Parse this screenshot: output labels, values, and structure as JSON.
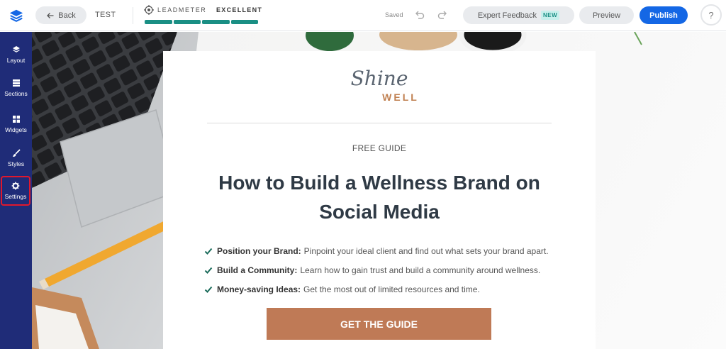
{
  "app": {
    "page_name": "TEST",
    "back_label": "Back",
    "leadmeter_label": "LEADMETER",
    "leadmeter_rating": "EXCELLENT",
    "saved_label": "Saved",
    "expert_feedback_label": "Expert Feedback",
    "new_badge": "NEW",
    "preview_label": "Preview",
    "publish_label": "Publish",
    "help_label": "?",
    "accent_color": "#1467e5",
    "leadmeter_color": "#1a8f84"
  },
  "sidebar": {
    "items": [
      {
        "label": "Layout",
        "icon": "layers-icon"
      },
      {
        "label": "Sections",
        "icon": "sections-icon"
      },
      {
        "label": "Widgets",
        "icon": "widgets-icon"
      },
      {
        "label": "Styles",
        "icon": "brush-icon"
      },
      {
        "label": "Settings",
        "icon": "gear-icon",
        "selected": true
      }
    ]
  },
  "landing": {
    "brand_script": "Shine",
    "brand_caps": "WELL",
    "eyebrow": "FREE GUIDE",
    "headline": "How to Build a Wellness Brand on Social Media",
    "benefits": [
      {
        "title": "Position your Brand:",
        "text": "Pinpoint your ideal client and find out what sets your brand apart."
      },
      {
        "title": "Build a Community:",
        "text": "Learn how to gain trust and build a community around wellness."
      },
      {
        "title": "Money-saving Ideas:",
        "text": "Get the most out of limited resources and time."
      }
    ],
    "cta_label": "GET THE GUIDE",
    "cta_color": "#bf7a56"
  }
}
